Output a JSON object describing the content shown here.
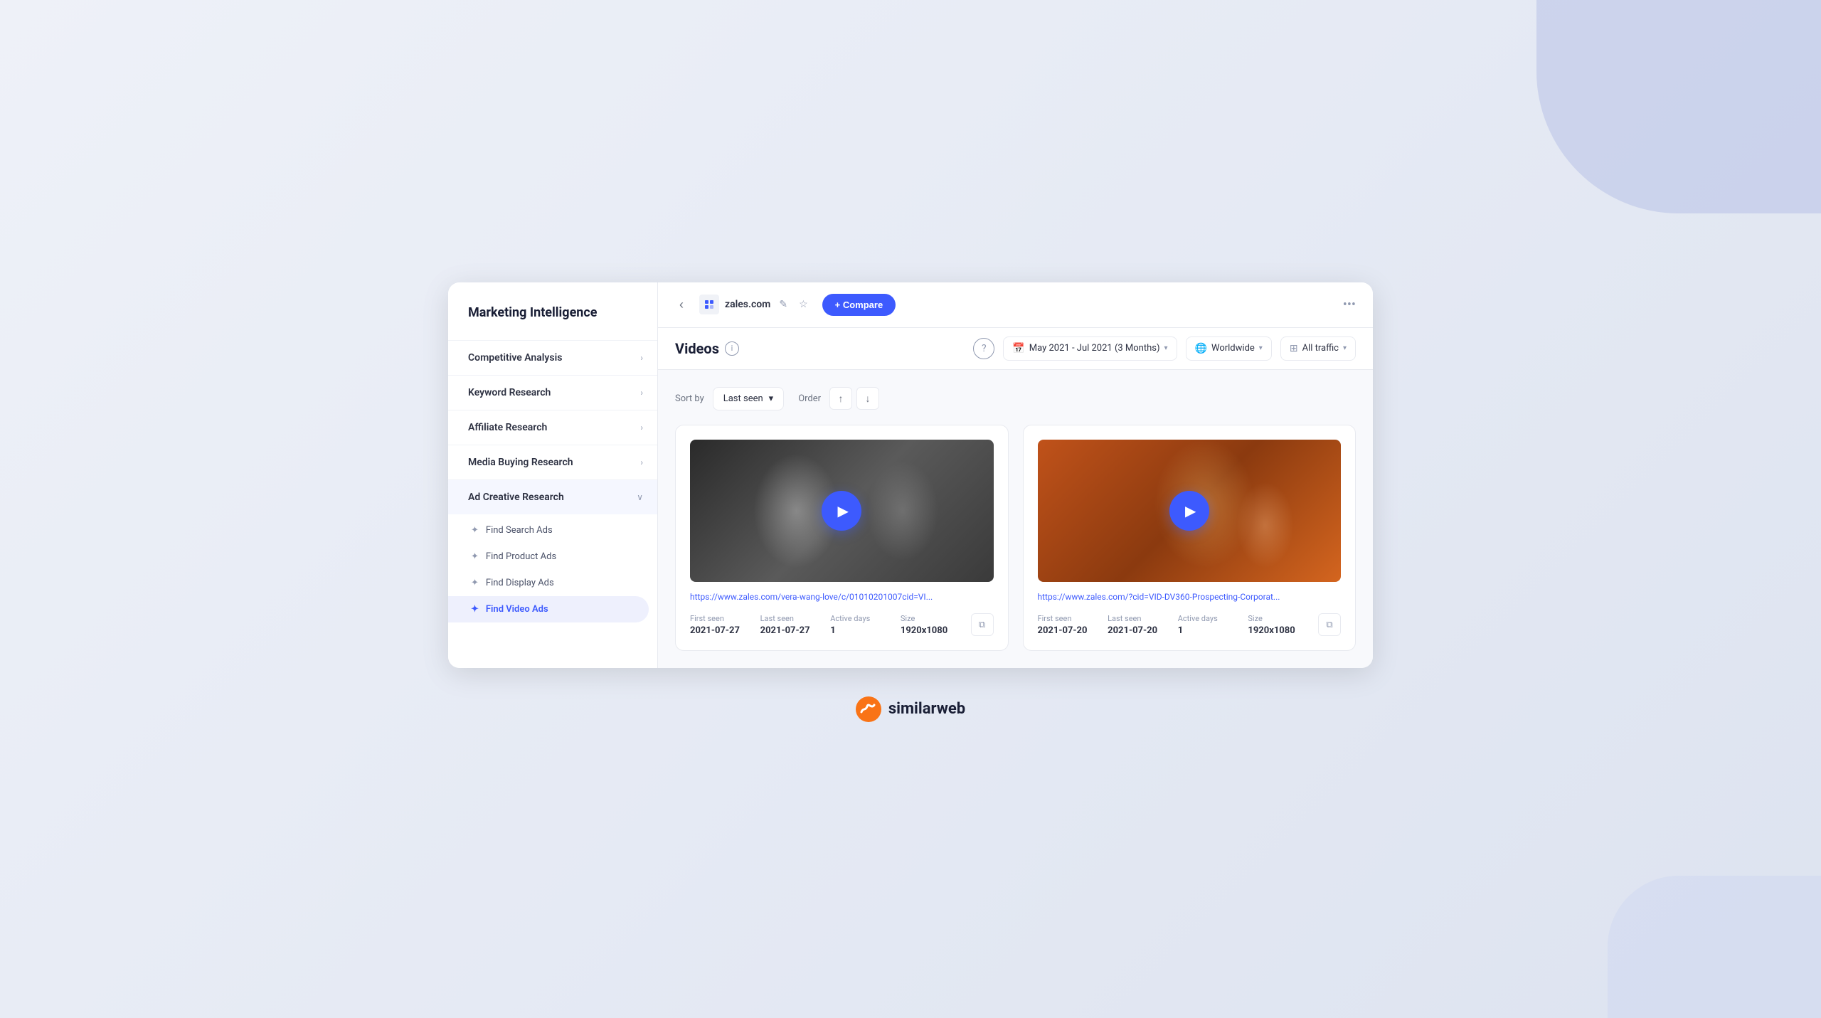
{
  "sidebar": {
    "title": "Marketing Intelligence",
    "nav_items": [
      {
        "id": "competitive-analysis",
        "label": "Competitive Analysis",
        "expanded": false
      },
      {
        "id": "keyword-research",
        "label": "Keyword Research",
        "expanded": false
      },
      {
        "id": "affiliate-research",
        "label": "Affiliate Research",
        "expanded": false
      },
      {
        "id": "media-buying-research",
        "label": "Media Buying Research",
        "expanded": false
      },
      {
        "id": "ad-creative-research",
        "label": "Ad Creative Research",
        "expanded": true,
        "sub_items": [
          {
            "id": "find-search-ads",
            "label": "Find Search Ads",
            "active": false
          },
          {
            "id": "find-product-ads",
            "label": "Find Product Ads",
            "active": false
          },
          {
            "id": "find-display-ads",
            "label": "Find Display Ads",
            "active": false
          },
          {
            "id": "find-video-ads",
            "label": "Find Video Ads",
            "active": true
          }
        ]
      }
    ]
  },
  "topbar": {
    "domain": "zales.com",
    "compare_label": "+ Compare"
  },
  "filters": {
    "page_title": "Videos",
    "date_range": "May 2021 - Jul 2021 (3 Months)",
    "location": "Worldwide",
    "traffic": "All traffic"
  },
  "sort": {
    "sort_by_label": "Sort by",
    "sort_option": "Last seen",
    "order_label": "Order"
  },
  "videos": [
    {
      "id": "video-1",
      "url": "https://www.zales.com/vera-wang-love/c/01010201007cid=VI...",
      "first_seen_label": "First seen",
      "first_seen": "2021-07-27",
      "last_seen_label": "Last seen",
      "last_seen": "2021-07-27",
      "active_days_label": "Active days",
      "active_days": "1",
      "size_label": "Size",
      "size": "1920x1080",
      "thumb_type": "bw"
    },
    {
      "id": "video-2",
      "url": "https://www.zales.com/?cid=VID-DV360-Prospecting-Corporat...",
      "first_seen_label": "First seen",
      "first_seen": "2021-07-20",
      "last_seen_label": "Last seen",
      "last_seen": "2021-07-20",
      "active_days_label": "Active days",
      "active_days": "1",
      "size_label": "Size",
      "size": "1920x1080",
      "thumb_type": "color"
    }
  ],
  "logo": {
    "text": "similarweb"
  }
}
